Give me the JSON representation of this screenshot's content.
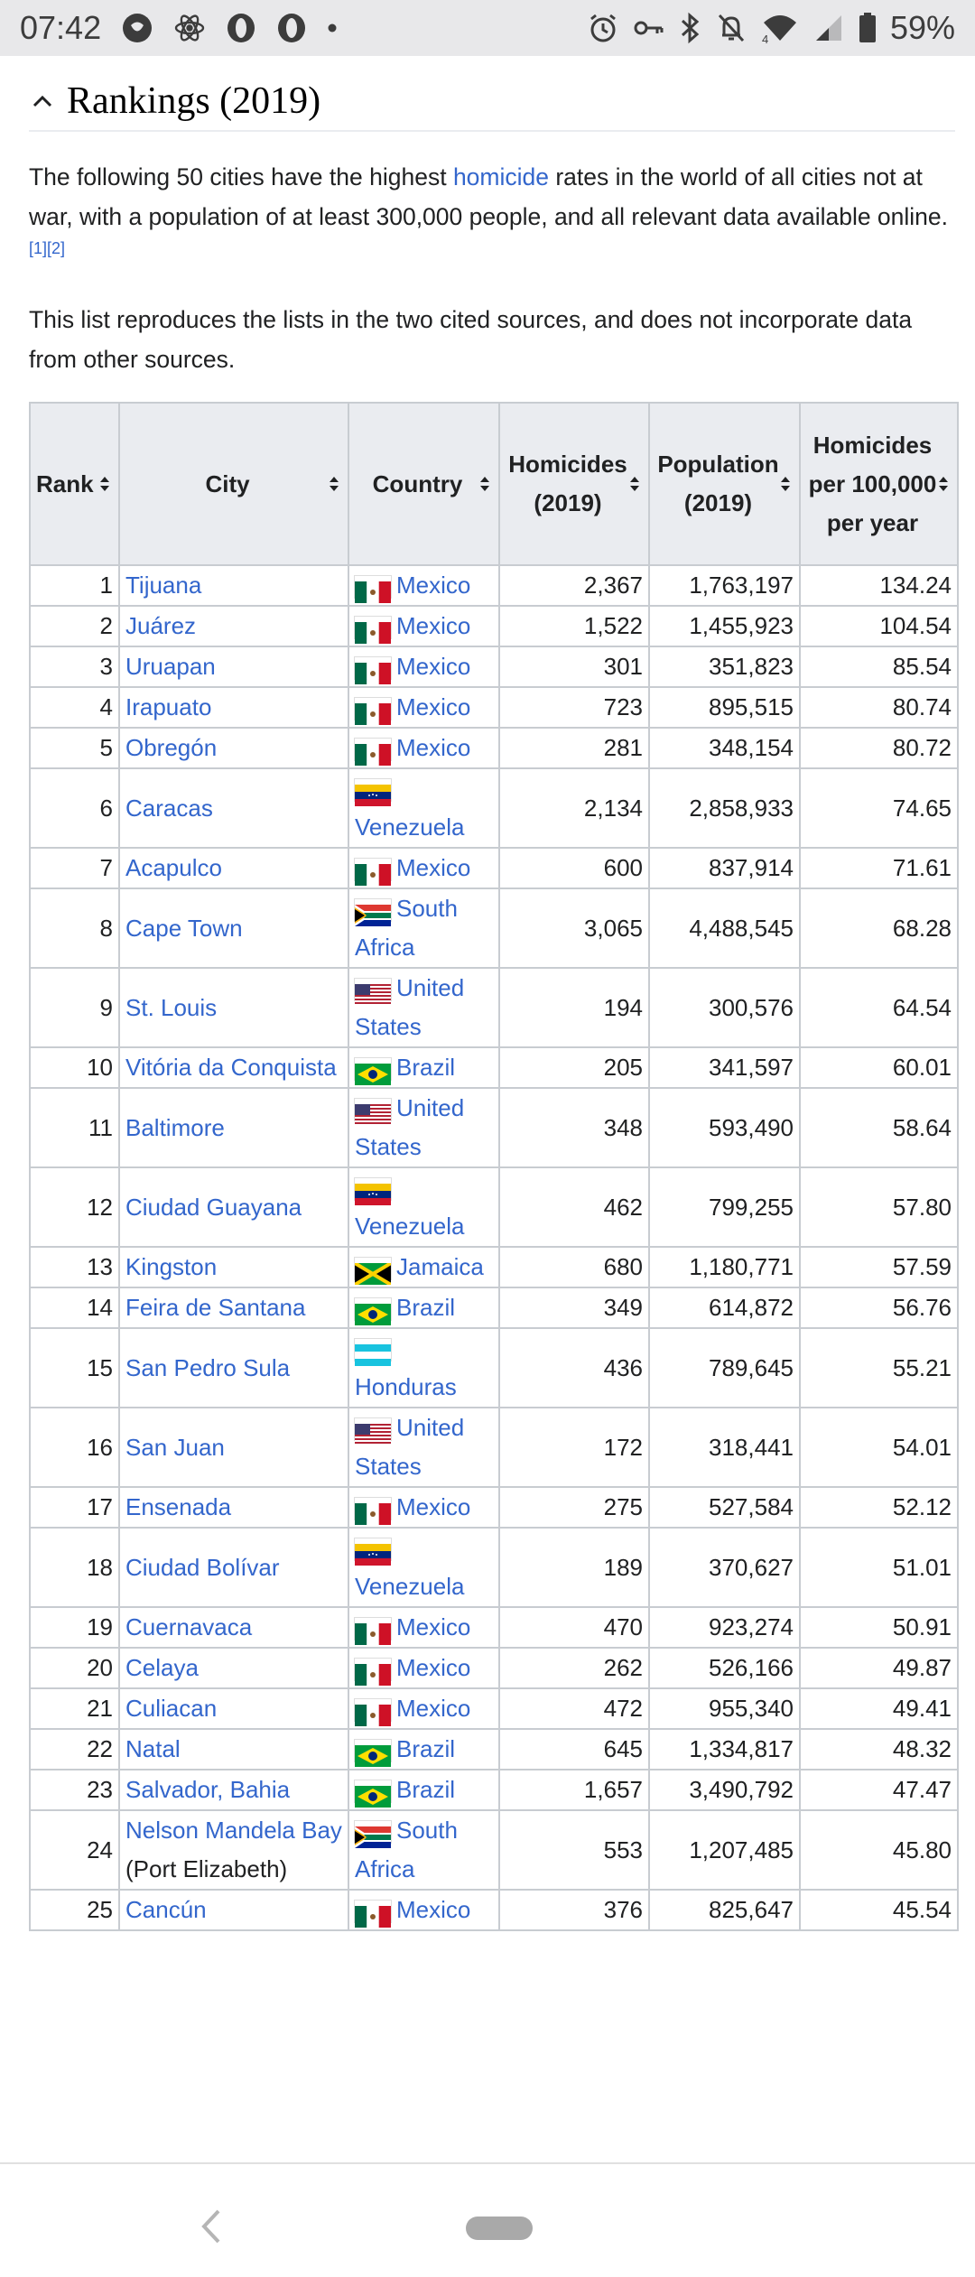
{
  "status": {
    "time": "07:42",
    "battery": "59%",
    "left_icons": [
      "pregnancy-app-icon",
      "react-icon",
      "opera-icon",
      "opera-icon",
      "dot-icon"
    ],
    "right_icons": [
      "alarm-icon",
      "key-icon",
      "bluetooth-icon",
      "mute-icon",
      "wifi-icon",
      "signal-icon",
      "battery-icon"
    ],
    "wifi_badge": "4"
  },
  "section": {
    "title": "Rankings (2019)"
  },
  "intro": {
    "text_before": "The following 50 cities have the highest ",
    "link": "homicide",
    "text_after": " rates in the world of all cities not at war, with a population of at least 300,000 people, and all relevant data available online.",
    "refs": "[1][2]"
  },
  "note": "This list reproduces the lists in the two cited sources, and does not incorporate data from other sources.",
  "table": {
    "headers": {
      "rank": "Rank",
      "city": "City",
      "country": "Country",
      "homicides": "Homicides (2019)",
      "population": "Population (2019)",
      "rate": "Homicides per 100,000 per year"
    },
    "rows": [
      {
        "rank": "1",
        "city": "Tijuana",
        "country": "Mexico",
        "flag": "mx",
        "homicides": "2,367",
        "population": "1,763,197",
        "rate": "134.24"
      },
      {
        "rank": "2",
        "city": "Juárez",
        "country": "Mexico",
        "flag": "mx",
        "homicides": "1,522",
        "population": "1,455,923",
        "rate": "104.54"
      },
      {
        "rank": "3",
        "city": "Uruapan",
        "country": "Mexico",
        "flag": "mx",
        "homicides": "301",
        "population": "351,823",
        "rate": "85.54"
      },
      {
        "rank": "4",
        "city": "Irapuato",
        "country": "Mexico",
        "flag": "mx",
        "homicides": "723",
        "population": "895,515",
        "rate": "80.74"
      },
      {
        "rank": "5",
        "city": "Obregón",
        "country": "Mexico",
        "flag": "mx",
        "homicides": "281",
        "population": "348,154",
        "rate": "80.72"
      },
      {
        "rank": "6",
        "city": "Caracas",
        "country": "Venezuela",
        "flag": "ve",
        "homicides": "2,134",
        "population": "2,858,933",
        "rate": "74.65"
      },
      {
        "rank": "7",
        "city": "Acapulco",
        "country": "Mexico",
        "flag": "mx",
        "homicides": "600",
        "population": "837,914",
        "rate": "71.61"
      },
      {
        "rank": "8",
        "city": "Cape Town",
        "country": "South Africa",
        "flag": "za",
        "homicides": "3,065",
        "population": "4,488,545",
        "rate": "68.28"
      },
      {
        "rank": "9",
        "city": "St. Louis",
        "country": "United States",
        "flag": "us",
        "homicides": "194",
        "population": "300,576",
        "rate": "64.54"
      },
      {
        "rank": "10",
        "city": "Vitória da Conquista",
        "country": "Brazil",
        "flag": "br",
        "homicides": "205",
        "population": "341,597",
        "rate": "60.01"
      },
      {
        "rank": "11",
        "city": "Baltimore",
        "country": "United States",
        "flag": "us",
        "homicides": "348",
        "population": "593,490",
        "rate": "58.64"
      },
      {
        "rank": "12",
        "city": "Ciudad Guayana",
        "country": "Venezuela",
        "flag": "ve",
        "homicides": "462",
        "population": "799,255",
        "rate": "57.80"
      },
      {
        "rank": "13",
        "city": "Kingston",
        "country": "Jamaica",
        "flag": "jm",
        "homicides": "680",
        "population": "1,180,771",
        "rate": "57.59"
      },
      {
        "rank": "14",
        "city": "Feira de Santana",
        "country": "Brazil",
        "flag": "br",
        "homicides": "349",
        "population": "614,872",
        "rate": "56.76"
      },
      {
        "rank": "15",
        "city": "San Pedro Sula",
        "country": "Honduras",
        "flag": "hn",
        "homicides": "436",
        "population": "789,645",
        "rate": "55.21"
      },
      {
        "rank": "16",
        "city": "San Juan",
        "country": "United States",
        "flag": "us",
        "homicides": "172",
        "population": "318,441",
        "rate": "54.01"
      },
      {
        "rank": "17",
        "city": "Ensenada",
        "country": "Mexico",
        "flag": "mx",
        "homicides": "275",
        "population": "527,584",
        "rate": "52.12"
      },
      {
        "rank": "18",
        "city": "Ciudad Bolívar",
        "country": "Venezuela",
        "flag": "ve",
        "homicides": "189",
        "population": "370,627",
        "rate": "51.01"
      },
      {
        "rank": "19",
        "city": "Cuernavaca",
        "country": "Mexico",
        "flag": "mx",
        "homicides": "470",
        "population": "923,274",
        "rate": "50.91"
      },
      {
        "rank": "20",
        "city": "Celaya",
        "country": "Mexico",
        "flag": "mx",
        "homicides": "262",
        "population": "526,166",
        "rate": "49.87"
      },
      {
        "rank": "21",
        "city": "Culiacan",
        "country": "Mexico",
        "flag": "mx",
        "homicides": "472",
        "population": "955,340",
        "rate": "49.41"
      },
      {
        "rank": "22",
        "city": "Natal",
        "country": "Brazil",
        "flag": "br",
        "homicides": "645",
        "population": "1,334,817",
        "rate": "48.32"
      },
      {
        "rank": "23",
        "city": "Salvador, Bahia",
        "country": "Brazil",
        "flag": "br",
        "homicides": "1,657",
        "population": "3,490,792",
        "rate": "47.47"
      },
      {
        "rank": "24",
        "city": "Nelson Mandela Bay",
        "city_note": "(Port Elizabeth)",
        "country": "South Africa",
        "flag": "za",
        "homicides": "553",
        "population": "1,207,485",
        "rate": "45.80"
      },
      {
        "rank": "25",
        "city": "Cancún",
        "country": "Mexico",
        "flag": "mx",
        "homicides": "376",
        "population": "825,647",
        "rate": "45.54"
      }
    ]
  },
  "colors": {
    "link": "#3366cc",
    "header_bg": "#eaecf0",
    "border": "#c8ccd1",
    "status_bg": "#e8e8ea"
  }
}
